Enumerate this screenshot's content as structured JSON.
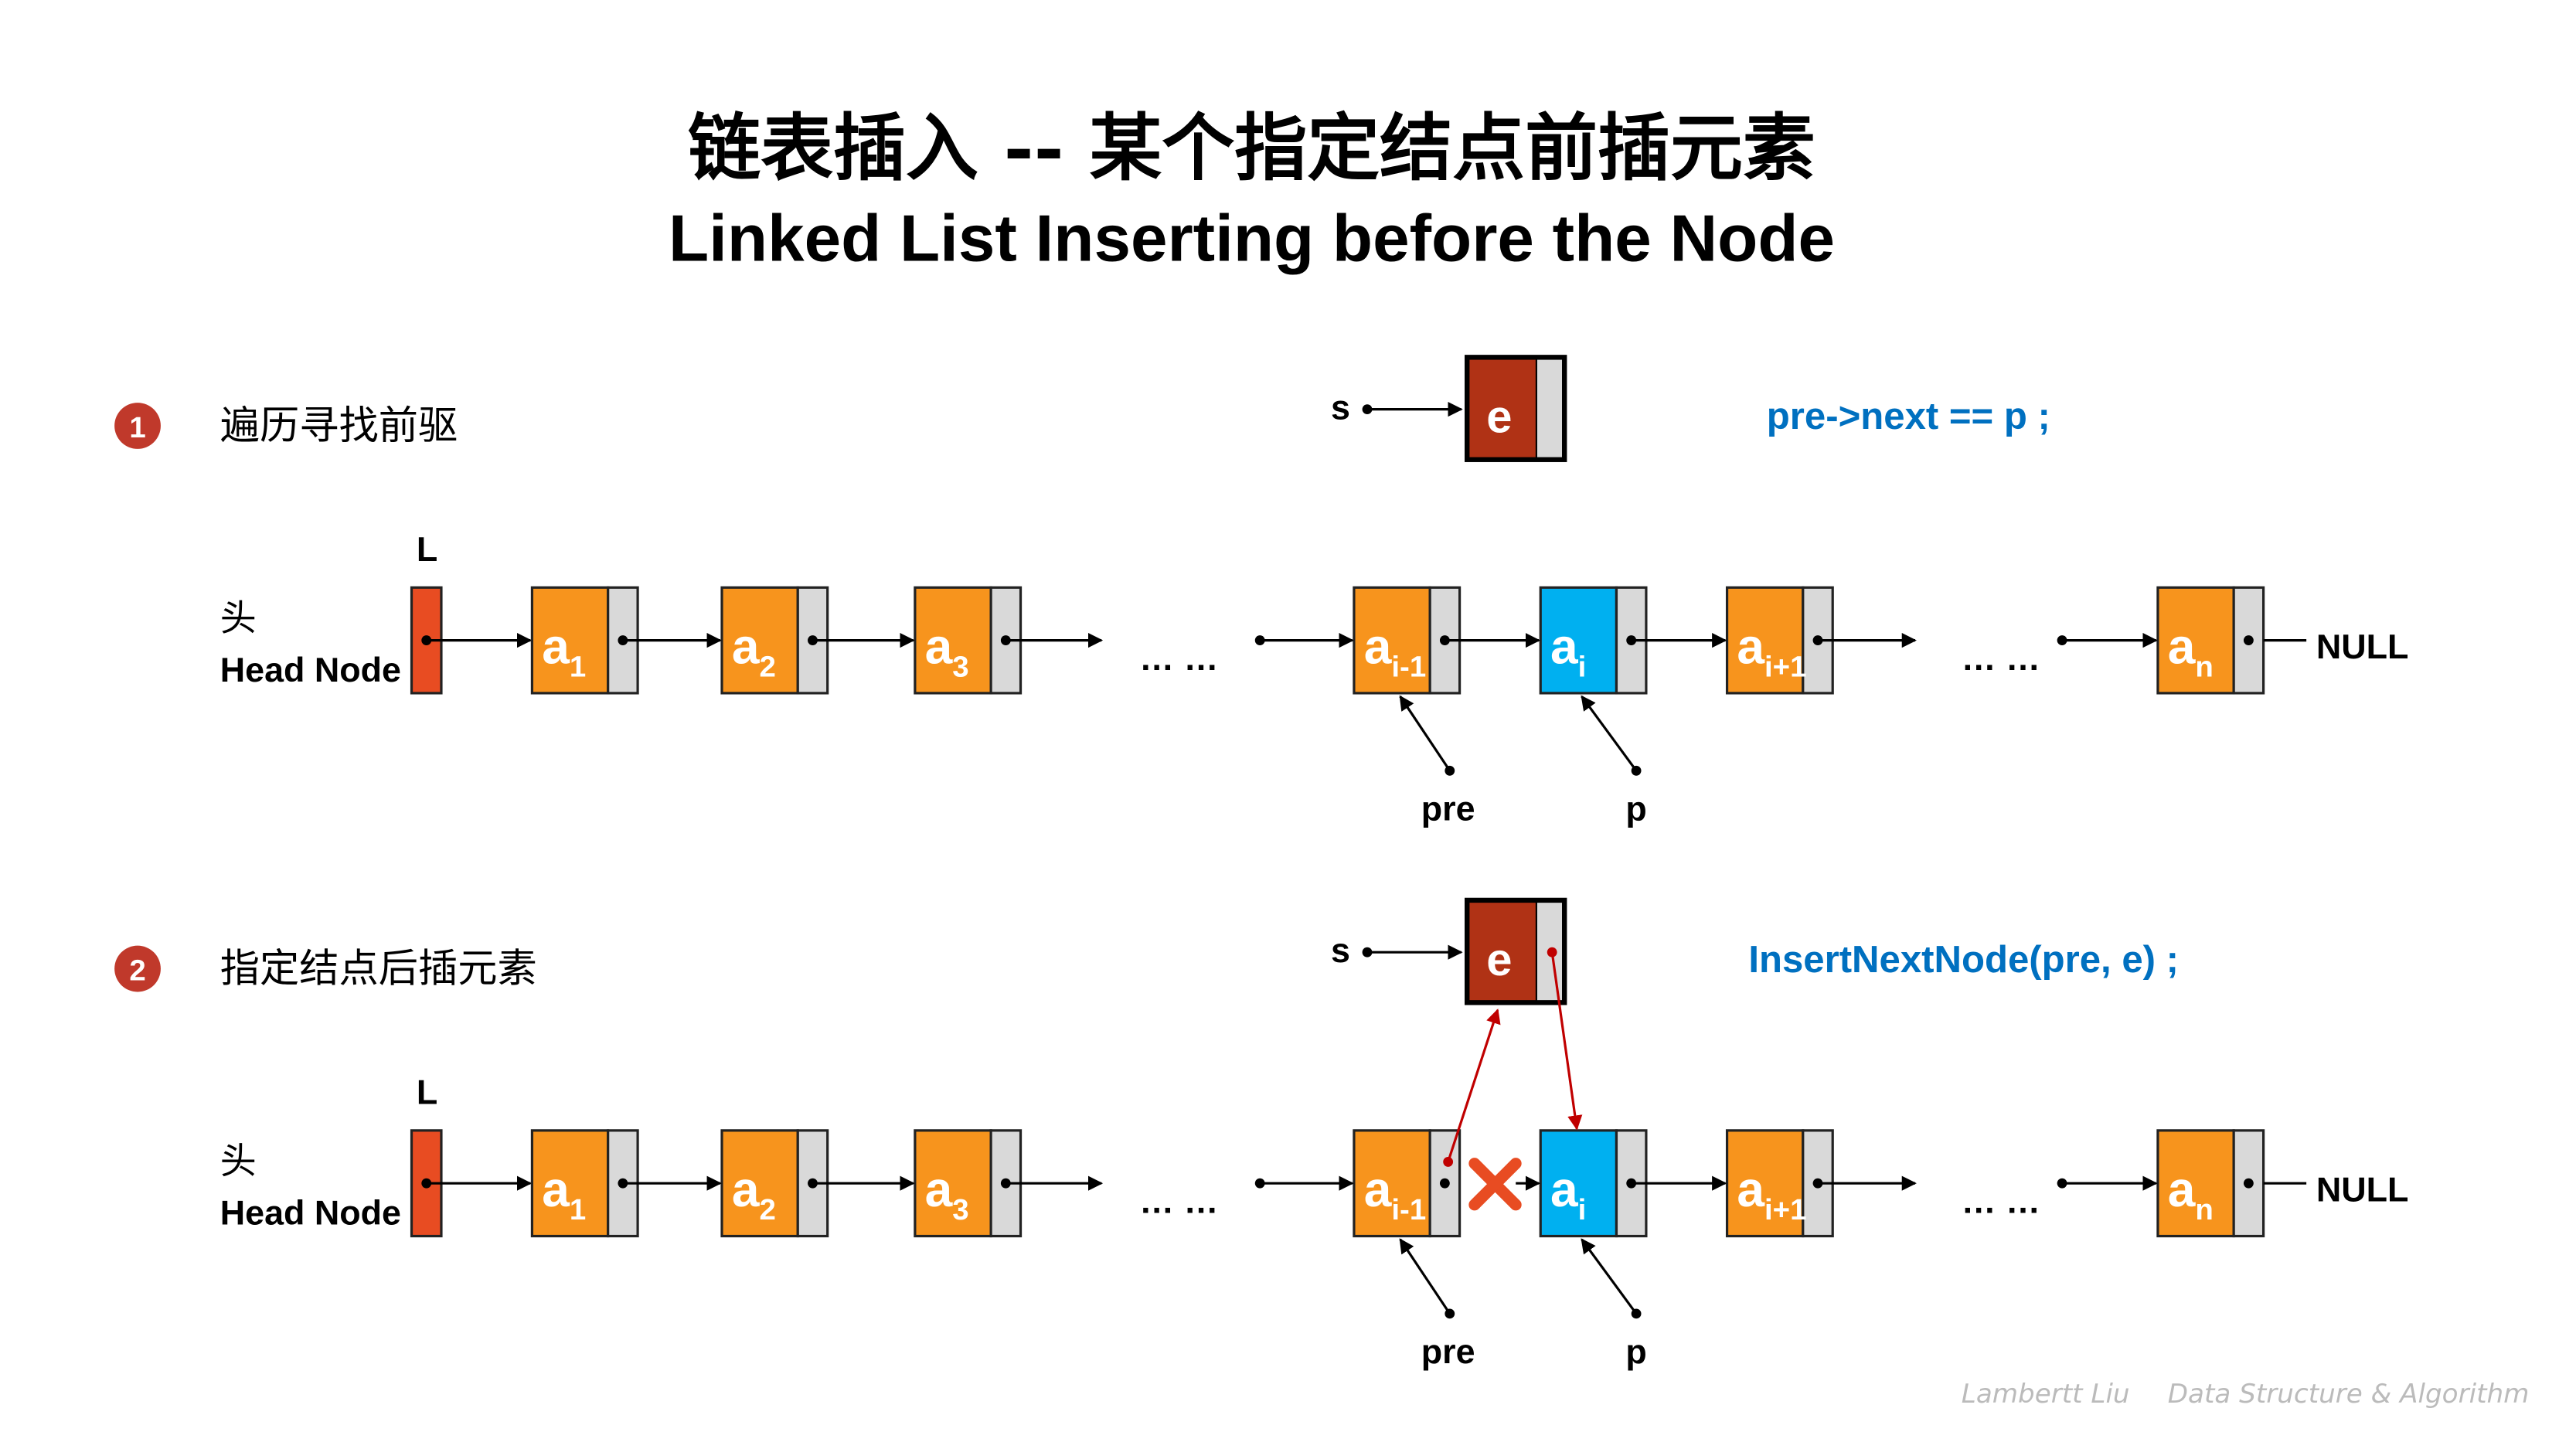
{
  "title": {
    "cn": "链表插入 -- 某个指定结点前插元素",
    "en": "Linked List Inserting before the Node"
  },
  "steps": [
    {
      "number": "1",
      "label": "遍历寻找前驱",
      "code": "pre->next == p ;"
    },
    {
      "number": "2",
      "label": "指定结点后插元素",
      "code": "InsertNextNode(pre, e) ;"
    }
  ],
  "labels": {
    "list_pointer": "L",
    "head_cn": "头",
    "head_en": "Head Node",
    "new_pointer": "s",
    "new_node": "e",
    "ellipsis": "… …",
    "null": "NULL",
    "pre": "pre",
    "p": "p"
  },
  "nodes": [
    {
      "base": "a",
      "sub": "1"
    },
    {
      "base": "a",
      "sub": "2"
    },
    {
      "base": "a",
      "sub": "3"
    },
    {
      "base": "a",
      "sub": "i-1"
    },
    {
      "base": "a",
      "sub": "i"
    },
    {
      "base": "a",
      "sub": "i+1"
    },
    {
      "base": "a",
      "sub": "n"
    }
  ],
  "colors": {
    "node": "#f7941d",
    "target": "#00b0f0",
    "head": "#e84c22",
    "new": "#b03215",
    "pointer_field": "#d9d9d9",
    "code": "#0070c0",
    "step_badge": "#c0392b",
    "insert_arrow": "#c00000"
  },
  "footer": {
    "author": "Lambertt Liu",
    "course": "Data Structure & Algorithm"
  }
}
